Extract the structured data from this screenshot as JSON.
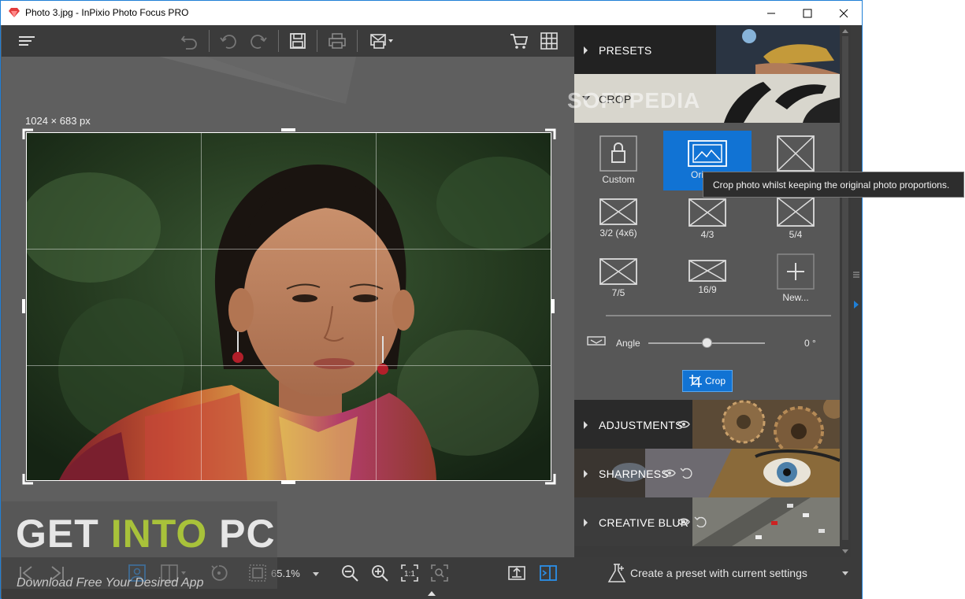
{
  "window": {
    "title": "Photo 3.jpg - InPixio Photo Focus PRO",
    "controls": {
      "minimize": "minimize-icon",
      "maximize": "maximize-icon",
      "close": "close-icon"
    }
  },
  "toolbar": {
    "icons": [
      "menu-icon",
      "undo-all-icon",
      "undo-icon",
      "redo-icon",
      "save-icon",
      "print-icon",
      "share-icon",
      "cart-icon",
      "grid-icon"
    ]
  },
  "canvas": {
    "dimensions_label": "1024 × 683 px"
  },
  "watermark": {
    "part1": "GET ",
    "part2": "INTO",
    "part3": " PC",
    "subtitle": "Download Free Your Desired App",
    "overlay": "SOFTPEDIA"
  },
  "bottombar": {
    "zoom": "65.1%",
    "icons": [
      "prev-icon",
      "next-icon",
      "single-view-icon",
      "compare-view-icon",
      "rotate-icon",
      "fit-icon",
      "zoom-out-icon",
      "zoom-in-icon",
      "actual-size-icon",
      "fit-screen-icon",
      "export-icon",
      "side-panel-icon"
    ]
  },
  "panel": {
    "presets_label": "PRESETS",
    "crop_label": "CROP",
    "ratios": [
      {
        "label": "Custom",
        "icon": "lock-icon"
      },
      {
        "label": "Original",
        "icon": "landscape-icon",
        "shown": "Ori"
      },
      {
        "label": "",
        "icon": "cross-box-icon"
      },
      {
        "label": "3/2 (4x6)",
        "icon": "cross-box-icon"
      },
      {
        "label": "4/3",
        "icon": "cross-box-icon"
      },
      {
        "label": "5/4",
        "icon": "cross-box-icon"
      },
      {
        "label": "7/5",
        "icon": "cross-box-icon"
      },
      {
        "label": "16/9",
        "icon": "cross-box-icon"
      },
      {
        "label": "New...",
        "icon": "plus-icon"
      }
    ],
    "angle_label": "Angle",
    "angle_value": "0 °",
    "angle_level": 0.5,
    "crop_button": "Crop",
    "adjustments_label": "ADJUSTMENTS",
    "sharpness_label": "SHARPNESS",
    "creative_blur_label": "CREATIVE BLUR",
    "footer_label": "Create a preset with current settings"
  },
  "tooltip": {
    "text": "Crop photo whilst keeping the original photo proportions."
  },
  "colors": {
    "accent": "#1173d4",
    "panel": "#4b4b4b",
    "toolbar": "#3b3b3b",
    "watermark_green": "#a8c23a"
  }
}
